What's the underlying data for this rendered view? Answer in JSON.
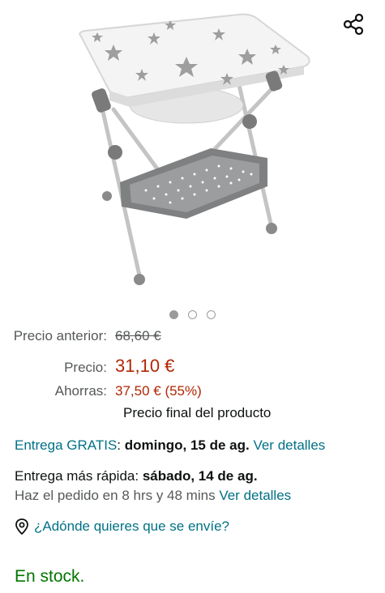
{
  "product": {
    "image_alt": "Bañera cambiador plegable con estampado de estrellas",
    "carousel": {
      "count": 3,
      "active_index": 0
    }
  },
  "pricing": {
    "previous_label": "Precio anterior:",
    "previous_value": "68,60 €",
    "price_label": "Precio:",
    "price_value": "31,10 €",
    "savings_label": "Ahorras:",
    "savings_value": "37,50 € (55%)",
    "final_note": "Precio final del producto"
  },
  "delivery": {
    "free_label": "Entrega GRATIS",
    "free_separator": ": ",
    "free_date": "domingo, 15 de ag.",
    "free_link": "Ver detalles",
    "fast_label": "Entrega más rápida",
    "fast_separator": ": ",
    "fast_date": "sábado, 14 de ag.",
    "order_time": "Haz el pedido en 8 hrs y 48 mins",
    "fast_link": "Ver detalles"
  },
  "location": {
    "text": "¿Adónde quieres que se envíe?"
  },
  "stock": {
    "text": "En stock."
  },
  "colors": {
    "price_red": "#b12704",
    "link_teal": "#007185",
    "stock_green": "#007600",
    "muted_gray": "#565959"
  },
  "icons": {
    "share": "share-icon",
    "location": "location-pin-icon"
  }
}
